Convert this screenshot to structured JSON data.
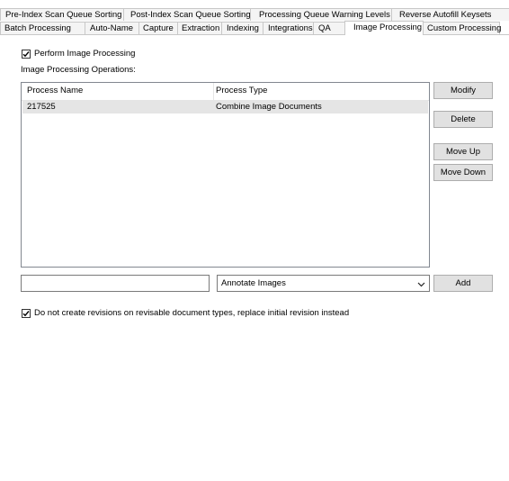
{
  "tabs": {
    "top_row": [
      "Pre-Index Scan Queue Sorting",
      "Post-Index Scan Queue Sorting",
      "Processing Queue Warning Levels",
      "Reverse Autofill Keysets"
    ],
    "bottom_row": [
      "Batch Processing",
      "Auto-Name",
      "Capture",
      "Extraction",
      "Indexing",
      "Integrations",
      "QA",
      "Image Processing",
      "Custom Processing"
    ],
    "active": "Image Processing"
  },
  "perform_checkbox": {
    "label": "Perform Image Processing",
    "checked": true
  },
  "operations_label": "Image Processing Operations:",
  "list": {
    "columns": [
      "Process Name",
      "Process Type"
    ],
    "rows": [
      {
        "name": "217525",
        "type": "Combine Image Documents",
        "selected": true
      }
    ]
  },
  "buttons": {
    "modify": "Modify",
    "delete": "Delete",
    "move_up": "Move Up",
    "move_down": "Move Down",
    "add": "Add"
  },
  "new_name_input": {
    "value": ""
  },
  "type_combo": {
    "selected": "Annotate Images"
  },
  "revisions_checkbox": {
    "label": "Do not create revisions on revisable document types, replace initial revision instead",
    "checked": true
  },
  "icons": {
    "checkbox_check": "checkmark-icon",
    "combo_arrow": "chevron-down-icon"
  }
}
